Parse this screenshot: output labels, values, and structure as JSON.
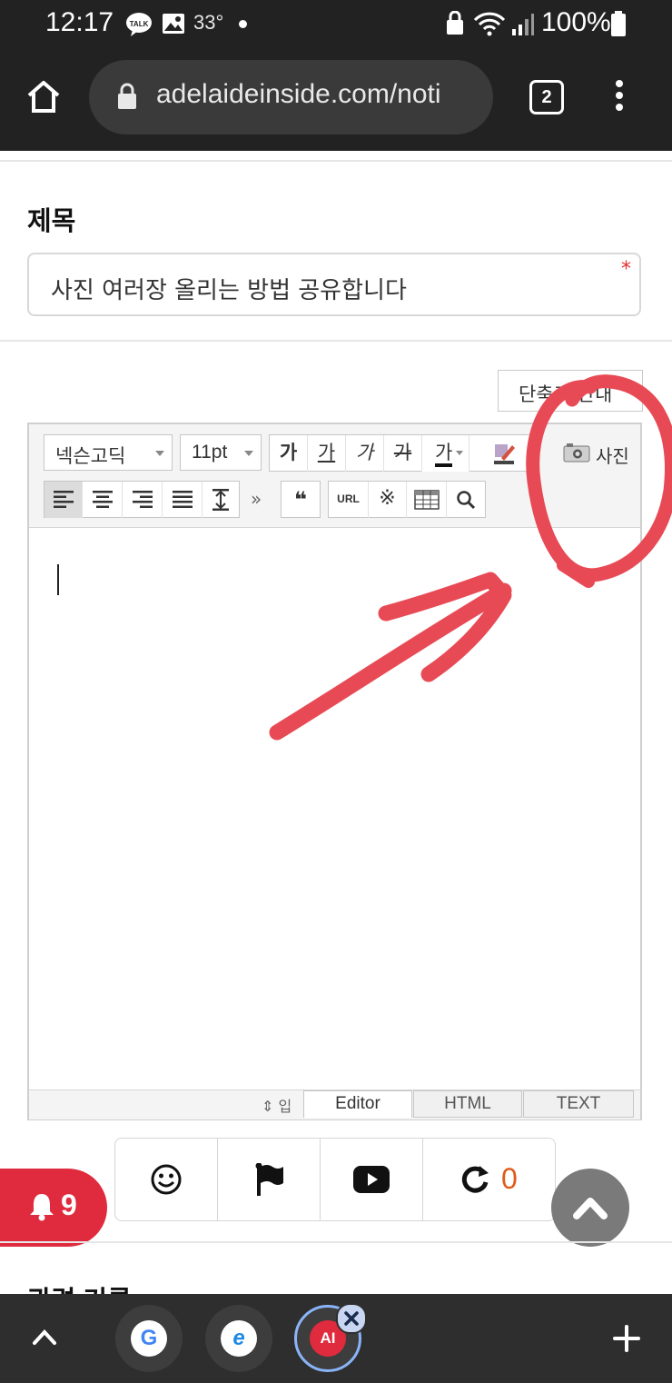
{
  "status_bar": {
    "time": "12:17",
    "talk_badge": "TALK",
    "temperature": "33°",
    "battery": "100%"
  },
  "browser": {
    "url": "adelaideinside.com/noti",
    "tab_count": "2"
  },
  "form": {
    "title_label": "제목",
    "title_value": "사진 여러장 올리는 방법 공유합니다",
    "required_mark": "*",
    "shortcut_button": "단축키 안내"
  },
  "editor": {
    "font_family": "넥슨고딕",
    "font_size": "11pt",
    "style_buttons": [
      "가",
      "가",
      "가",
      "가",
      "가"
    ],
    "photo_button": "사진",
    "more_glyph": "»",
    "quote_glyph": "❝",
    "url_button": "URL",
    "special_char_glyph": "※",
    "resize_label": "입",
    "modes": [
      "Editor",
      "HTML",
      "TEXT"
    ]
  },
  "bottom_tools": {
    "refresh_count": "0"
  },
  "notifications": {
    "count": "9"
  },
  "next_section_title": "관련 기록",
  "bottom_nav": {
    "tabs": [
      {
        "letter": "G",
        "color": "#4285f4"
      },
      {
        "letter": "e",
        "color": "#1e88e5"
      },
      {
        "letter": "AI",
        "color": "#e02b3e"
      }
    ]
  },
  "annotation_color": "#e84a55"
}
